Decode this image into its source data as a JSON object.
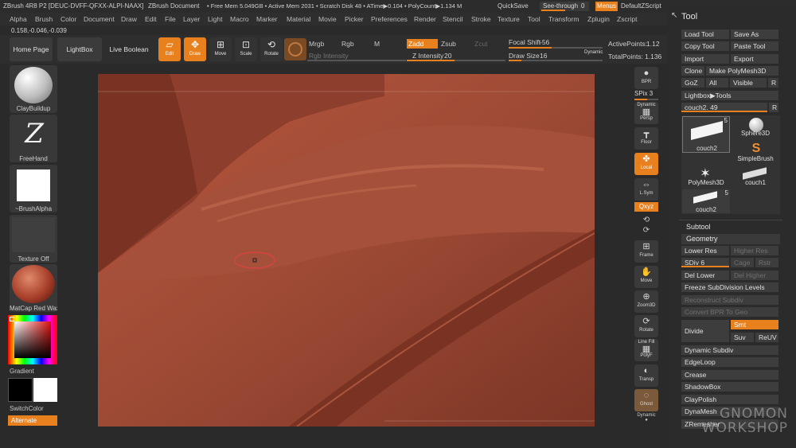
{
  "titlebar": {
    "app": "ZBrush 4R8 P2 [DEUC-DVFF-QFXX-ALPI-NAAX]",
    "doc": "ZBrush Document",
    "stats": "• Free Mem 5.049GB • Active Mem 2031 • Scratch Disk 48 • ATime▶0.104 • PolyCount▶1.134 M",
    "quicksave": "QuickSave",
    "seethrough": "See-through",
    "seethrough_value": "0",
    "menus": "Menus",
    "default_zscript": "DefaultZScript"
  },
  "menubar": [
    "Alpha",
    "Brush",
    "Color",
    "Document",
    "Draw",
    "Edit",
    "File",
    "Layer",
    "Light",
    "Macro",
    "Marker",
    "Material",
    "Movie",
    "Picker",
    "Preferences",
    "Render",
    "Stencil",
    "Stroke",
    "Texture",
    "Tool",
    "Transform",
    "Zplugin",
    "Zscript"
  ],
  "coords": "0.158,-0.046,-0.039",
  "toolbar": {
    "home_page": "Home Page",
    "lightbox": "LightBox",
    "live_boolean": "Live Boolean",
    "edit": "Edit",
    "draw": "Draw",
    "move": "Move",
    "scale": "Scale",
    "rotate": "Rotate",
    "mrgb": "Mrgb",
    "rgb": "Rgb",
    "m": "M",
    "rgb_intensity": "Rgb Intensity",
    "zadd": "Zadd",
    "zsub": "Zsub",
    "zcut": "Zcut",
    "z_intensity_label": "Z Intensity",
    "z_intensity": "20",
    "focal_shift_label": "Focal Shift",
    "focal_shift": "-56",
    "draw_size_label": "Draw Size",
    "draw_size": "16",
    "dynamic": "Dynamic",
    "active_points_label": "ActivePoints:",
    "active_points": "1.12",
    "total_points_label": "TotalPoints:",
    "total_points": "1.136"
  },
  "left_shelf": {
    "brush": "ClayBuildup",
    "stroke": "FreeHand",
    "alpha": "~BrushAlpha",
    "texture": "Texture Off",
    "material": "MatCap Red Wax",
    "gradient": "Gradient",
    "switch_color": "SwitchColor",
    "alternate": "Alternate"
  },
  "right_shelf": {
    "bpr": "BPR",
    "spix_label": "SPix",
    "spix": "3",
    "dynamic": "Dynamic",
    "persp": "Persp",
    "floor": "Floor",
    "local": "Local",
    "lsym": "L.Sym",
    "xyz": "Qxyz",
    "frame": "Frame",
    "move": "Move",
    "zoom3d": "Zoom3D",
    "rotate": "Rotate",
    "line_fill": "Line Fill",
    "polyf": "PolyF",
    "transp": "Transp",
    "ghost": "Ghost",
    "solo": "Dynamic"
  },
  "tool_panel": {
    "title": "Tool",
    "load_tool": "Load Tool",
    "save_as": "Save As",
    "copy_tool": "Copy Tool",
    "paste_tool": "Paste Tool",
    "import": "Import",
    "export": "Export",
    "clone": "Clone",
    "make_polymesh": "Make PolyMesh3D",
    "goz": "GoZ",
    "all": "All",
    "visible": "Visible",
    "r": "R",
    "lightbox_tools": "Lightbox▶Tools",
    "current_tool_label": "couch2.",
    "current_tool_value": "49",
    "thumbs": [
      {
        "label": "couch2",
        "count": "5"
      },
      {
        "label": "Sphere3D",
        "count": ""
      },
      {
        "label": "SimpleBrush",
        "count": ""
      },
      {
        "label": "PolyMesh3D",
        "count": ""
      },
      {
        "label": "couch1",
        "count": ""
      },
      {
        "label": "couch2",
        "count": "5"
      }
    ],
    "subtool": "Subtool",
    "geometry": "Geometry",
    "lower_res": "Lower Res",
    "higher_res": "Higher Res",
    "sdiv_label": "SDiv",
    "sdiv": "6",
    "cage": "Cage",
    "rstr": "Rstr",
    "del_lower": "Del Lower",
    "del_higher": "Del Higher",
    "freeze_subdiv": "Freeze SubDivision Levels",
    "reconstruct_subdiv": "Reconstruct Subdiv",
    "convert_bpr": "Convert BPR To Geo",
    "divide": "Divide",
    "smt": "Smt",
    "suv": "Suv",
    "reuv": "ReUV",
    "dynamic_subdiv": "Dynamic Subdiv",
    "edgeloop": "EdgeLoop",
    "crease": "Crease",
    "shadowbox": "ShadowBox",
    "claypolish": "ClayPolish",
    "dynamesh": "DynaMesh",
    "zremesher": "ZRemesher"
  },
  "watermark": {
    "line1": "GNOMON",
    "line2": "WORKSHOP"
  }
}
